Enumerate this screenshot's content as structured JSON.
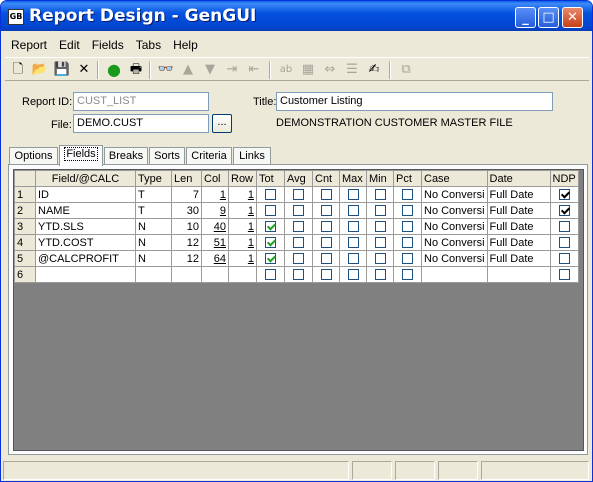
{
  "window": {
    "title": "Report Design - GenGUI",
    "app_icon_text": "GB"
  },
  "menu": [
    "Report",
    "Edit",
    "Fields",
    "Tabs",
    "Help"
  ],
  "toolbar_icons": [
    "new-icon",
    "open-icon",
    "save-icon",
    "delete-icon",
    "run-icon",
    "print-icon",
    "find-icon",
    "move-up-icon",
    "move-down-icon",
    "indent-icon",
    "outdent-icon",
    "text-field-icon",
    "calc-icon",
    "link-icon",
    "list-icon",
    "edit-check-icon",
    "properties-icon"
  ],
  "header": {
    "report_id_label": "Report ID:",
    "report_id_value": "CUST_LIST",
    "title_label": "Title:",
    "title_value": "Customer Listing",
    "file_label": "File:",
    "file_value": "DEMO.CUST",
    "browse_label": "...",
    "file_description": "DEMONSTRATION CUSTOMER MASTER FILE"
  },
  "tabs": [
    "Options",
    "Fields",
    "Breaks",
    "Sorts",
    "Criteria",
    "Links"
  ],
  "active_tab": "Fields",
  "grid": {
    "columns": [
      "Field/@CALC",
      "Type",
      "Len",
      "Col",
      "Row",
      "Tot",
      "Avg",
      "Cnt",
      "Max",
      "Min",
      "Pct",
      "Case",
      "Date",
      "NDP"
    ],
    "rows": [
      {
        "num": "1",
        "field": "ID",
        "type": "T",
        "len": "7",
        "col": "1",
        "row": "1",
        "tot": false,
        "avg": false,
        "cnt": false,
        "max": false,
        "min": false,
        "pct": false,
        "case": "No Conversi",
        "date": "Full Date",
        "ndp": true
      },
      {
        "num": "2",
        "field": "NAME",
        "type": "T",
        "len": "30",
        "col": "9",
        "row": "1",
        "tot": false,
        "avg": false,
        "cnt": false,
        "max": false,
        "min": false,
        "pct": false,
        "case": "No Conversi",
        "date": "Full Date",
        "ndp": true
      },
      {
        "num": "3",
        "field": "YTD.SLS",
        "type": "N",
        "len": "10",
        "col": "40",
        "row": "1",
        "tot": true,
        "avg": false,
        "cnt": false,
        "max": false,
        "min": false,
        "pct": false,
        "case": "No Conversi",
        "date": "Full Date",
        "ndp": false
      },
      {
        "num": "4",
        "field": "YTD.COST",
        "type": "N",
        "len": "12",
        "col": "51",
        "row": "1",
        "tot": true,
        "avg": false,
        "cnt": false,
        "max": false,
        "min": false,
        "pct": false,
        "case": "No Conversi",
        "date": "Full Date",
        "ndp": false
      },
      {
        "num": "5",
        "field": "@CALCPROFIT",
        "type": "N",
        "len": "12",
        "col": "64",
        "row": "1",
        "tot": true,
        "avg": false,
        "cnt": false,
        "max": false,
        "min": false,
        "pct": false,
        "case": "No Conversi",
        "date": "Full Date",
        "ndp": false
      },
      {
        "num": "6",
        "field": "",
        "type": "",
        "len": "",
        "col": "",
        "row": "",
        "tot": false,
        "avg": false,
        "cnt": false,
        "max": false,
        "min": false,
        "pct": false,
        "case": "",
        "date": "",
        "ndp": false
      }
    ]
  }
}
